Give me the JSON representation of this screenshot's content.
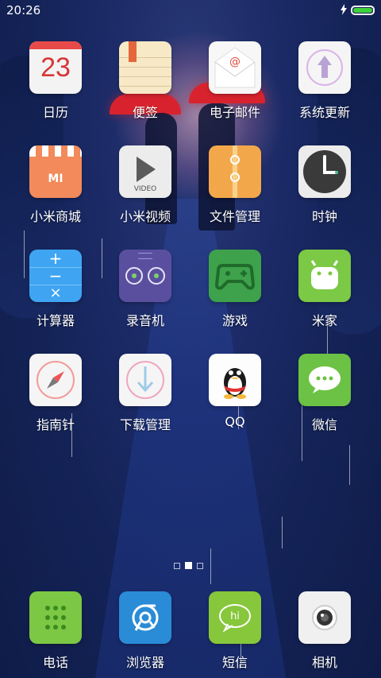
{
  "status_bar": {
    "time": "20:26"
  },
  "apps": [
    {
      "label": "日历",
      "icon": "calendar-icon",
      "number": "23"
    },
    {
      "label": "便签",
      "icon": "notes-icon"
    },
    {
      "label": "电子邮件",
      "icon": "email-icon"
    },
    {
      "label": "系统更新",
      "icon": "system-update-icon"
    },
    {
      "label": "小米商城",
      "icon": "mi-store-icon",
      "badge": "MI"
    },
    {
      "label": "小米视频",
      "icon": "video-icon",
      "badge": "VIDEO"
    },
    {
      "label": "文件管理",
      "icon": "file-manager-icon"
    },
    {
      "label": "时钟",
      "icon": "clock-icon"
    },
    {
      "label": "计算器",
      "icon": "calculator-icon"
    },
    {
      "label": "录音机",
      "icon": "recorder-icon"
    },
    {
      "label": "游戏",
      "icon": "game-controller-icon"
    },
    {
      "label": "米家",
      "icon": "mijia-icon"
    },
    {
      "label": "指南针",
      "icon": "compass-icon"
    },
    {
      "label": "下载管理",
      "icon": "download-icon"
    },
    {
      "label": "QQ",
      "icon": "qq-penguin-icon"
    },
    {
      "label": "微信",
      "icon": "wechat-icon"
    }
  ],
  "dock": [
    {
      "label": "电话",
      "icon": "phone-dialpad-icon"
    },
    {
      "label": "浏览器",
      "icon": "browser-icon"
    },
    {
      "label": "短信",
      "icon": "sms-icon",
      "badge": "hi"
    },
    {
      "label": "相机",
      "icon": "camera-icon"
    }
  ],
  "page_indicator": {
    "pages": 3,
    "current": 2
  },
  "colors": {
    "battery_fill": "#3fd23b",
    "wallpaper_base": "#142357"
  }
}
